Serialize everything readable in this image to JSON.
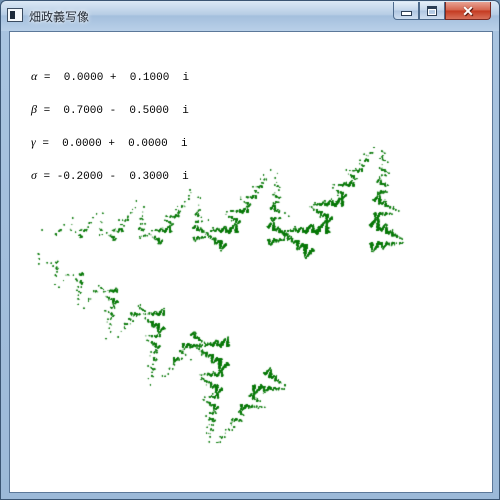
{
  "window": {
    "title": "畑政義写像",
    "controls": {
      "minimize": "minimize",
      "maximize": "maximize",
      "close": "close"
    }
  },
  "params": [
    {
      "symbol": "α",
      "text": " =  0.0000 +  0.1000  i"
    },
    {
      "symbol": "β",
      "text": " =  0.7000 -  0.5000  i"
    },
    {
      "symbol": "γ",
      "text": " =  0.0000 +  0.0000  i"
    },
    {
      "symbol": "σ",
      "text": " = -0.2000 -  0.3000  i"
    }
  ],
  "fractal": {
    "color": "#0b7a0b",
    "alpha": [
      0.0,
      0.1
    ],
    "beta": [
      0.7,
      -0.5
    ],
    "gamma": [
      0.0,
      0.0
    ],
    "delta": [
      -0.2,
      -0.3
    ]
  },
  "colors": {
    "titlebar": "#b7cde5",
    "client_background": "#ffffff",
    "close_button": "#c4391f"
  }
}
